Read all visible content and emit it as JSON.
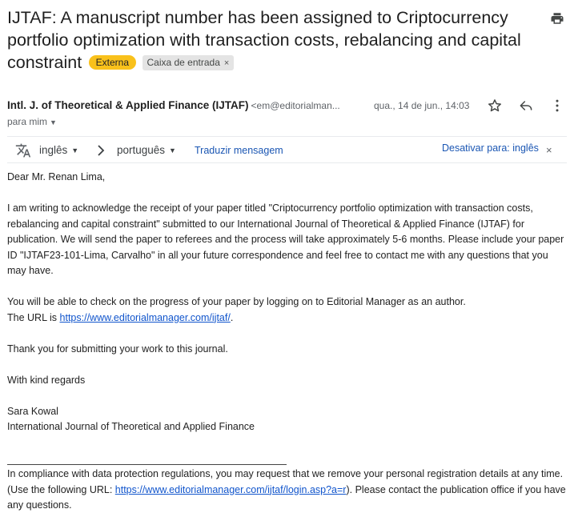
{
  "email": {
    "subject": "IJTAF: A manuscript number has been assigned to Criptocurrency portfolio optimization with transaction costs, rebalancing and capital constraint",
    "labels": {
      "external": "Externa",
      "inbox": "Caixa de entrada",
      "inbox_remove": "×"
    },
    "sender": {
      "name": "Intl. J. of Theoretical & Applied Finance (IJTAF)",
      "email": "<em@editorialman..."
    },
    "date": "qua., 14 de jun., 14:03",
    "to": "para mim"
  },
  "translate": {
    "source_lang": "inglês",
    "target_lang": "português",
    "translate_link": "Traduzir mensagem",
    "disable_link": "Desativar para: inglês",
    "disable_close": "×"
  },
  "body": {
    "greeting": "Dear Mr. Renan Lima,",
    "para1": "I am writing to acknowledge the receipt of your paper titled \"Criptocurrency portfolio optimization with transaction costs, rebalancing and capital constraint\" submitted to our International Journal of Theoretical & Applied Finance (IJTAF) for publication. We will send the paper to referees and the process will take approximately 5-6 months. Please include your paper ID \"IJTAF23-101-Lima, Carvalho\" in all your future correspondence and feel free to contact me with any questions that you may have.",
    "para2_line1": "You will be able to check on the progress of your paper by logging on to Editorial Manager as an author.",
    "para2_prefix": "The URL is ",
    "para2_link": "https://www.editorialmanager.com/ijtaf/",
    "para2_suffix": ".",
    "thanks": "Thank you for submitting your work to this journal.",
    "regards": "With kind regards",
    "signature_name": "Sara Kowal",
    "signature_org": "International Journal of Theoretical and Applied Finance",
    "footer_prefix": "In compliance with data protection regulations, you may request that we remove your personal registration details at any time.  (Use the following URL: ",
    "footer_link": "https://www.editorialmanager.com/ijtaf/login.asp?a=r",
    "footer_suffix": "). Please contact the publication office if you have any questions."
  },
  "icons": {
    "print": "printer-icon",
    "star": "star-icon",
    "reply": "reply-icon",
    "more": "more-vert-icon",
    "translate": "translate-icon",
    "arrow": "chevron-right-icon"
  },
  "colors": {
    "external_chip": "#f9c11b",
    "inbox_chip": "#e4e4e4",
    "link": "#1155cc",
    "translate_link": "#1a56b3"
  }
}
